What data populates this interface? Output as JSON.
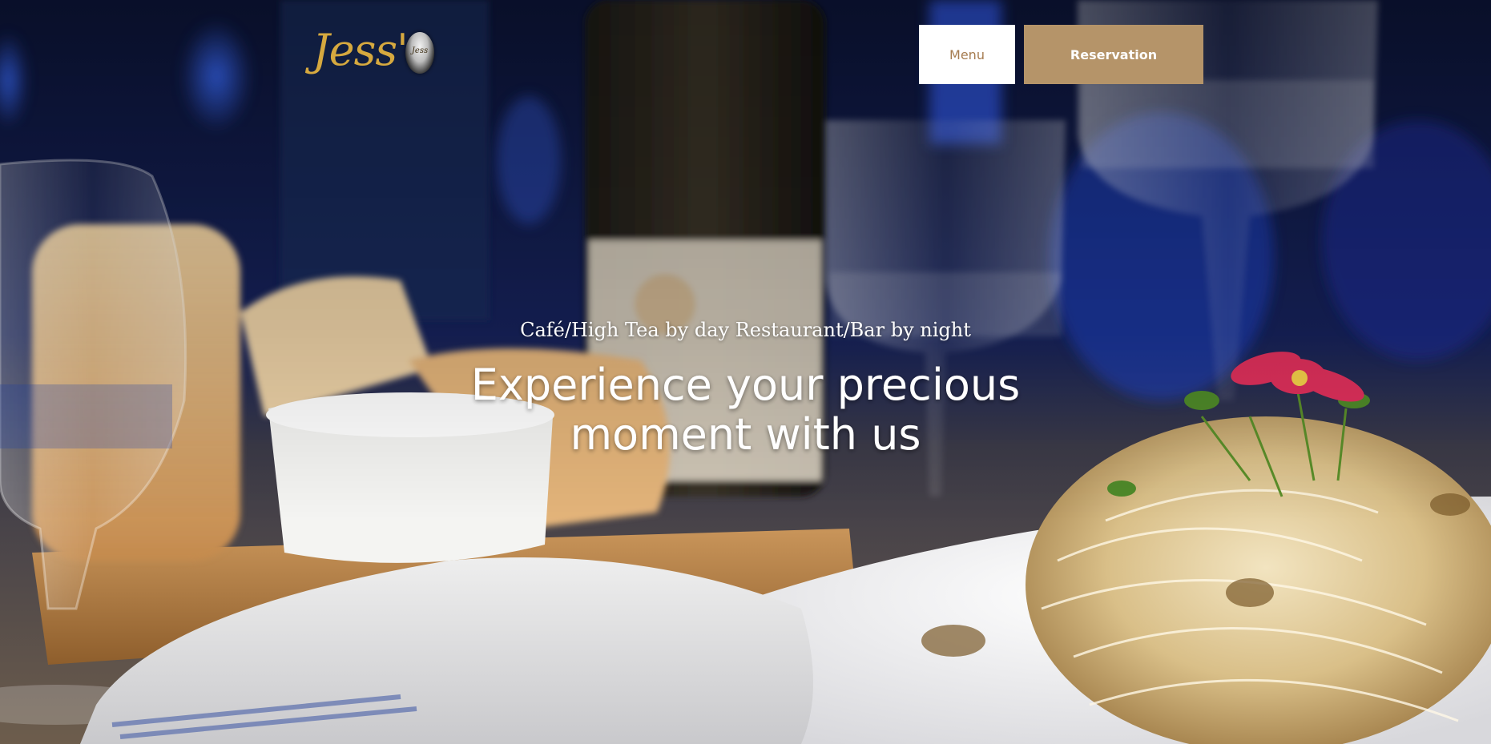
{
  "brand": {
    "logo_text": "Jess'",
    "badge_text": "Jess"
  },
  "nav": {
    "menu_label": "Menu",
    "reservation_label": "Reservation"
  },
  "hero": {
    "tagline": "Café/High Tea by day Restaurant/Bar by night",
    "headline_line1": "Experience your precious",
    "headline_line2": "moment with us"
  },
  "colors": {
    "accent": "#b59469",
    "logo_gold": "#d6a93f",
    "menu_text": "#a67c50"
  }
}
